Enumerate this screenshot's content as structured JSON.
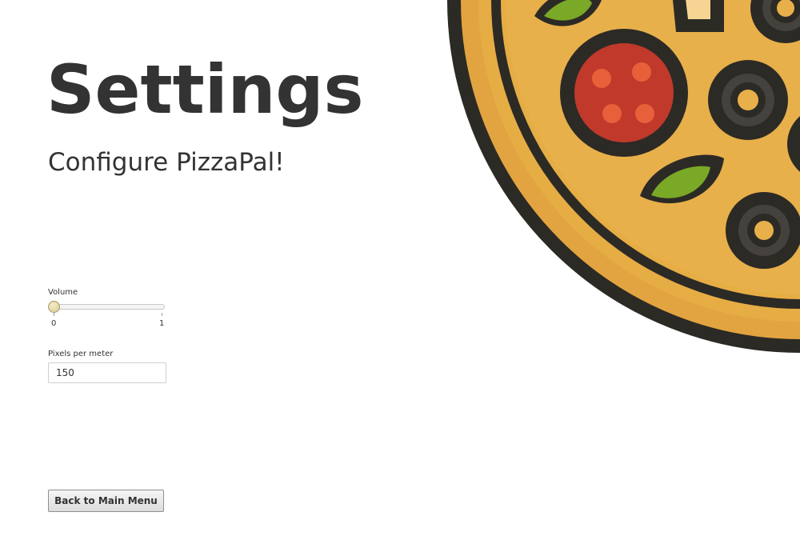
{
  "page": {
    "title": "Settings",
    "subtitle": "Configure PizzaPal!"
  },
  "volume": {
    "label": "Volume",
    "min_label": "0",
    "max_label": "1",
    "value": 0
  },
  "pixels_per_meter": {
    "label": "Pixels per meter",
    "value": "150"
  },
  "actions": {
    "back_label": "Back to Main Menu"
  },
  "decoration": {
    "icon": "pizza-illustration",
    "colors": {
      "outline": "#2c2a25",
      "crust": "#e6ad45",
      "pepperoni": "#c0392b",
      "pepperoni_spots": "#e8603a",
      "basil": "#7aa827",
      "olive": "#393633",
      "cheese": "#f6d594"
    }
  }
}
